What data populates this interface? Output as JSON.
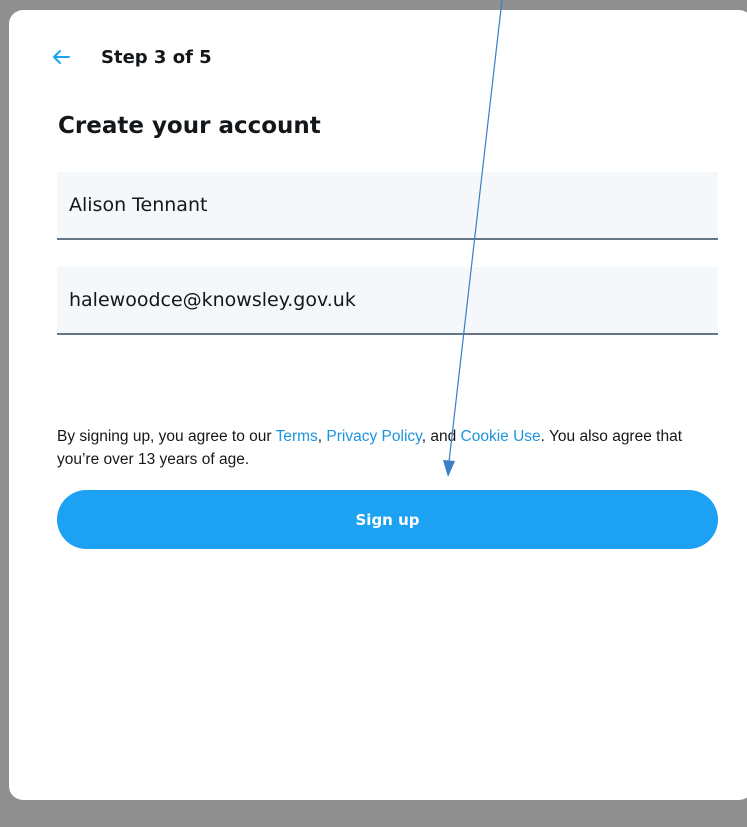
{
  "header": {
    "back_icon": "arrow-left-icon",
    "step_label": "Step 3 of 5"
  },
  "title": "Create your account",
  "form": {
    "name_value": "Alison Tennant",
    "email_value": "halewoodce@knowsley.gov.uk"
  },
  "terms": {
    "prefix": "By signing up, you agree to our ",
    "terms_link": "Terms",
    "sep1": ", ",
    "privacy_link": "Privacy Policy",
    "sep2": ", and ",
    "cookie_link": "Cookie Use",
    "suffix": ". You also agree that you’re over 13 years of age."
  },
  "signup_button": "Sign up",
  "colors": {
    "accent": "#1da1f2",
    "link": "#1b95e0",
    "backdrop": "#8f8f8f",
    "annotation_arrow": "#3a7ec4"
  }
}
